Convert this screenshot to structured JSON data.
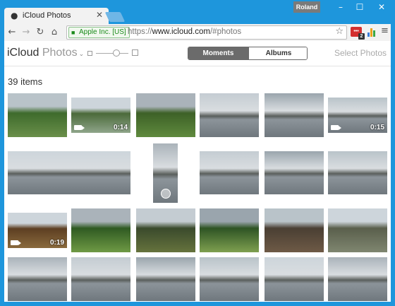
{
  "browser": {
    "tab_title": "iCloud Photos",
    "tab_close_glyph": "✕",
    "profile_name": "Roland",
    "window_controls": {
      "minimize": "–",
      "maximize": "☐",
      "close": "✕"
    },
    "nav": {
      "back": "←",
      "forward": "→",
      "reload": "↻",
      "home": "⌂"
    },
    "security_label": "Apple Inc. [US]",
    "url_scheme": "https://",
    "url_host": "www.icloud.com",
    "url_path": "/#photos",
    "star_glyph": "☆",
    "menu_glyph": "≡",
    "extension_badge": "2",
    "accent_color": "#1e96dc"
  },
  "app": {
    "brand_name": "iCloud",
    "section_name": "Photos",
    "section_caret": "⌄",
    "zoom_level": 0.62,
    "view_tabs": [
      {
        "label": "Moments",
        "selected": true
      },
      {
        "label": "Albums",
        "selected": false
      }
    ],
    "select_label": "Select Photos",
    "item_count": "39 items"
  },
  "photos": [
    {
      "name": "photo-garden-path",
      "kind": "photo"
    },
    {
      "name": "video-cottage",
      "kind": "video",
      "duration": "0:14"
    },
    {
      "name": "photo-lawn-trees",
      "kind": "photo"
    },
    {
      "name": "photo-lake-boats",
      "kind": "photo"
    },
    {
      "name": "photo-lake-tree",
      "kind": "photo"
    },
    {
      "name": "video-lakeshore",
      "kind": "video",
      "duration": "0:15"
    },
    {
      "name": "photo-pier-wide",
      "kind": "photo"
    },
    {
      "name": "photo-panorama-vertical",
      "kind": "panorama"
    },
    {
      "name": "photo-lake-hills",
      "kind": "photo"
    },
    {
      "name": "photo-lake-grey",
      "kind": "photo"
    },
    {
      "name": "photo-lake-tree-right",
      "kind": "photo"
    },
    {
      "name": "video-autumn-woods",
      "kind": "video",
      "duration": "0:19"
    },
    {
      "name": "photo-hedge-lawn",
      "kind": "photo"
    },
    {
      "name": "photo-garden-topiary",
      "kind": "photo"
    },
    {
      "name": "photo-topiary-house",
      "kind": "photo"
    },
    {
      "name": "photo-garden-fence",
      "kind": "photo"
    },
    {
      "name": "photo-manor-house",
      "kind": "photo"
    },
    {
      "name": "photo-lake-swans",
      "kind": "photo"
    },
    {
      "name": "photo-lake-evening",
      "kind": "photo"
    },
    {
      "name": "photo-jetty-dark",
      "kind": "photo"
    },
    {
      "name": "photo-lake-sunset",
      "kind": "photo"
    },
    {
      "name": "photo-boardwalk",
      "kind": "photo"
    },
    {
      "name": "photo-pier-long",
      "kind": "photo"
    },
    {
      "name": "photo-lake-dusk",
      "kind": "photo"
    }
  ]
}
